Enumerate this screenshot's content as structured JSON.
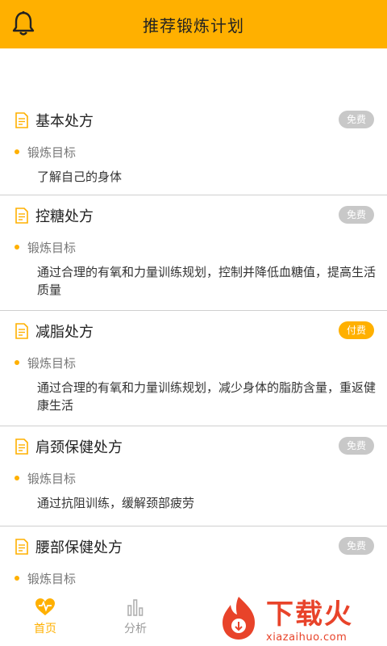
{
  "header": {
    "title": "推荐锻炼计划",
    "icon": "bell-icon",
    "color": "#FFB000"
  },
  "plans": [
    {
      "name": "基本处方",
      "tag": "免费",
      "goal_label": "锻炼目标",
      "description": "了解自己的身体"
    },
    {
      "name": "控糖处方",
      "tag": "免费",
      "goal_label": "锻炼目标",
      "description": "通过合理的有氧和力量训练规划，控制并降低血糖值，提高生活质量"
    },
    {
      "name": "减脂处方",
      "tag": "付费",
      "goal_label": "锻炼目标",
      "description": "通过合理的有氧和力量训练规划，减少身体的脂肪含量，重返健康生活"
    },
    {
      "name": "肩颈保健处方",
      "tag": "免费",
      "goal_label": "锻炼目标",
      "description": "通过抗阻训练，缓解颈部疲劳"
    },
    {
      "name": "腰部保健处方",
      "tag": "免费",
      "goal_label": "锻炼目标",
      "description": ""
    }
  ],
  "bottom_nav": [
    {
      "label": "首页",
      "icon": "home-heart-icon",
      "active": true
    },
    {
      "label": "分析",
      "icon": "bar-chart-icon",
      "active": false
    }
  ],
  "watermark": {
    "main_text": "下载火",
    "sub_text": "xiazaihuo.com"
  }
}
